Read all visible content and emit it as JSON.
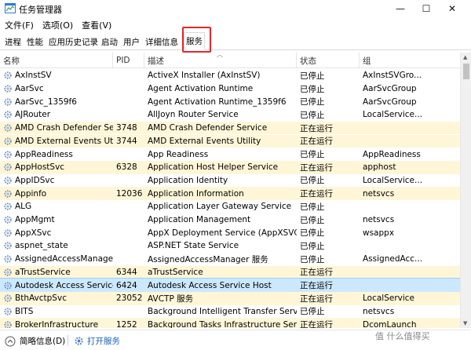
{
  "window": {
    "title": "任务管理器",
    "minimize": "—",
    "maximize": "☐",
    "close": "✕"
  },
  "menu": [
    "文件(F)",
    "选项(O)",
    "查看(V)"
  ],
  "tabs": [
    "进程",
    "性能",
    "应用历史记录",
    "启动",
    "用户",
    "详细信息",
    "服务"
  ],
  "active_tab": "服务",
  "columns": {
    "name": "名称",
    "pid": "PID",
    "desc": "描述",
    "status": "状态",
    "group": "组"
  },
  "rows": [
    {
      "name": "AxInstSV",
      "pid": "",
      "desc": "ActiveX Installer (AxInstSV)",
      "status": "已停止",
      "group": "AxInstSVGro..."
    },
    {
      "name": "AarSvc",
      "pid": "",
      "desc": "Agent Activation Runtime",
      "status": "已停止",
      "group": "AarSvcGroup"
    },
    {
      "name": "AarSvc_1359f6",
      "pid": "",
      "desc": "Agent Activation Runtime_1359f6",
      "status": "已停止",
      "group": "AarSvcGroup"
    },
    {
      "name": "AJRouter",
      "pid": "",
      "desc": "AllJoyn Router Service",
      "status": "已停止",
      "group": "LocalService..."
    },
    {
      "name": "AMD Crash Defender Se...",
      "pid": "3748",
      "desc": "AMD Crash Defender Service",
      "status": "正在运行",
      "group": ""
    },
    {
      "name": "AMD External Events Utili...",
      "pid": "3744",
      "desc": "AMD External Events Utility",
      "status": "正在运行",
      "group": ""
    },
    {
      "name": "AppReadiness",
      "pid": "",
      "desc": "App Readiness",
      "status": "已停止",
      "group": "AppReadiness"
    },
    {
      "name": "AppHostSvc",
      "pid": "6328",
      "desc": "Application Host Helper Service",
      "status": "正在运行",
      "group": "apphost"
    },
    {
      "name": "AppIDSvc",
      "pid": "",
      "desc": "Application Identity",
      "status": "已停止",
      "group": "LocalService..."
    },
    {
      "name": "Appinfo",
      "pid": "12036",
      "desc": "Application Information",
      "status": "正在运行",
      "group": "netsvcs"
    },
    {
      "name": "ALG",
      "pid": "",
      "desc": "Application Layer Gateway Service",
      "status": "已停止",
      "group": ""
    },
    {
      "name": "AppMgmt",
      "pid": "",
      "desc": "Application Management",
      "status": "已停止",
      "group": "netsvcs"
    },
    {
      "name": "AppXSvc",
      "pid": "",
      "desc": "AppX Deployment Service (AppXSVC)",
      "status": "已停止",
      "group": "wsappx"
    },
    {
      "name": "aspnet_state",
      "pid": "",
      "desc": "ASP.NET State Service",
      "status": "已停止",
      "group": ""
    },
    {
      "name": "AssignedAccessManager...",
      "pid": "",
      "desc": "AssignedAccessManager 服务",
      "status": "已停止",
      "group": "AssignedAcc..."
    },
    {
      "name": "aTrustService",
      "pid": "6344",
      "desc": "aTrustService",
      "status": "正在运行",
      "group": ""
    },
    {
      "name": "Autodesk Access Service...",
      "pid": "6424",
      "desc": "Autodesk Access Service Host",
      "status": "正在运行",
      "group": ""
    },
    {
      "name": "BthAvctpSvc",
      "pid": "23052",
      "desc": "AVCTP 服务",
      "status": "正在运行",
      "group": "LocalService"
    },
    {
      "name": "BITS",
      "pid": "",
      "desc": "Background Intelligent Transfer Service",
      "status": "已停止",
      "group": "netsvcs"
    },
    {
      "name": "BrokerInfrastructure",
      "pid": "1252",
      "desc": "Background Tasks Infrastructure Serv...",
      "status": "正在运行",
      "group": "DcomLaunch"
    }
  ],
  "selected_row": "Autodesk Access Service...",
  "footer": {
    "fewer_details": "简略信息(D)",
    "open_services": "打开服务"
  },
  "watermark": "值 什么值得买",
  "colors": {
    "highlight_box": "#e5262b",
    "selected_row": "#cce8ff",
    "running_shade": "#fff6d8",
    "link": "#1a5fb4"
  }
}
